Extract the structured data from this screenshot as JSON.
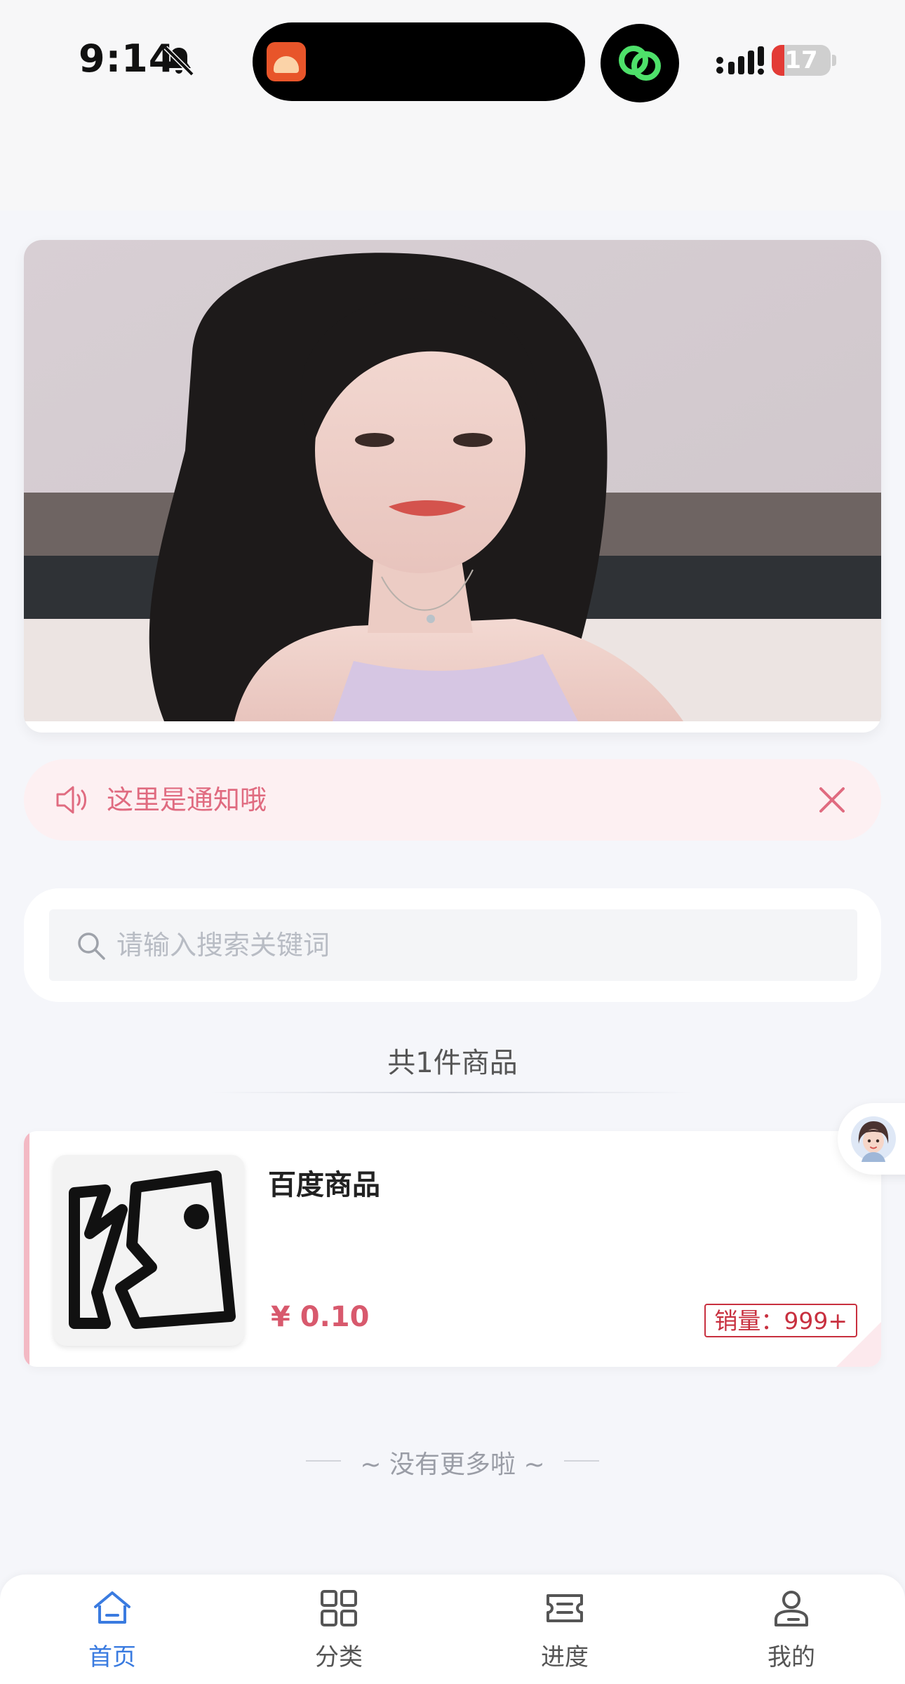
{
  "status_bar": {
    "time": "9:14",
    "battery": "17",
    "icons": [
      "bell-off-icon",
      "app-icon",
      "link-icon",
      "signal-icon",
      "battery-icon"
    ]
  },
  "banner": {
    "image_alt": "banner photo",
    "icon": "banner-image"
  },
  "notice": {
    "text": "这里是通知哦",
    "icon": "speaker-icon",
    "close_icon": "close-icon",
    "color": "#e06b80"
  },
  "search": {
    "placeholder": "请输入搜索关键词",
    "value": "",
    "icon": "search-icon"
  },
  "product_list": {
    "count_label": "共1件商品",
    "items": [
      {
        "name": "百度商品",
        "price": "¥ 0.10",
        "sales": "销量：999+",
        "thumbnail_icon": "broken-image-icon"
      }
    ],
    "end_text": "~ 没有更多啦 ~"
  },
  "tabbar": {
    "active_color": "#3a7be0",
    "items": [
      {
        "label": "首页",
        "icon": "home-icon",
        "active": true
      },
      {
        "label": "分类",
        "icon": "grid-icon",
        "active": false
      },
      {
        "label": "进度",
        "icon": "ticket-icon",
        "active": false
      },
      {
        "label": "我的",
        "icon": "user-icon",
        "active": false
      }
    ]
  }
}
